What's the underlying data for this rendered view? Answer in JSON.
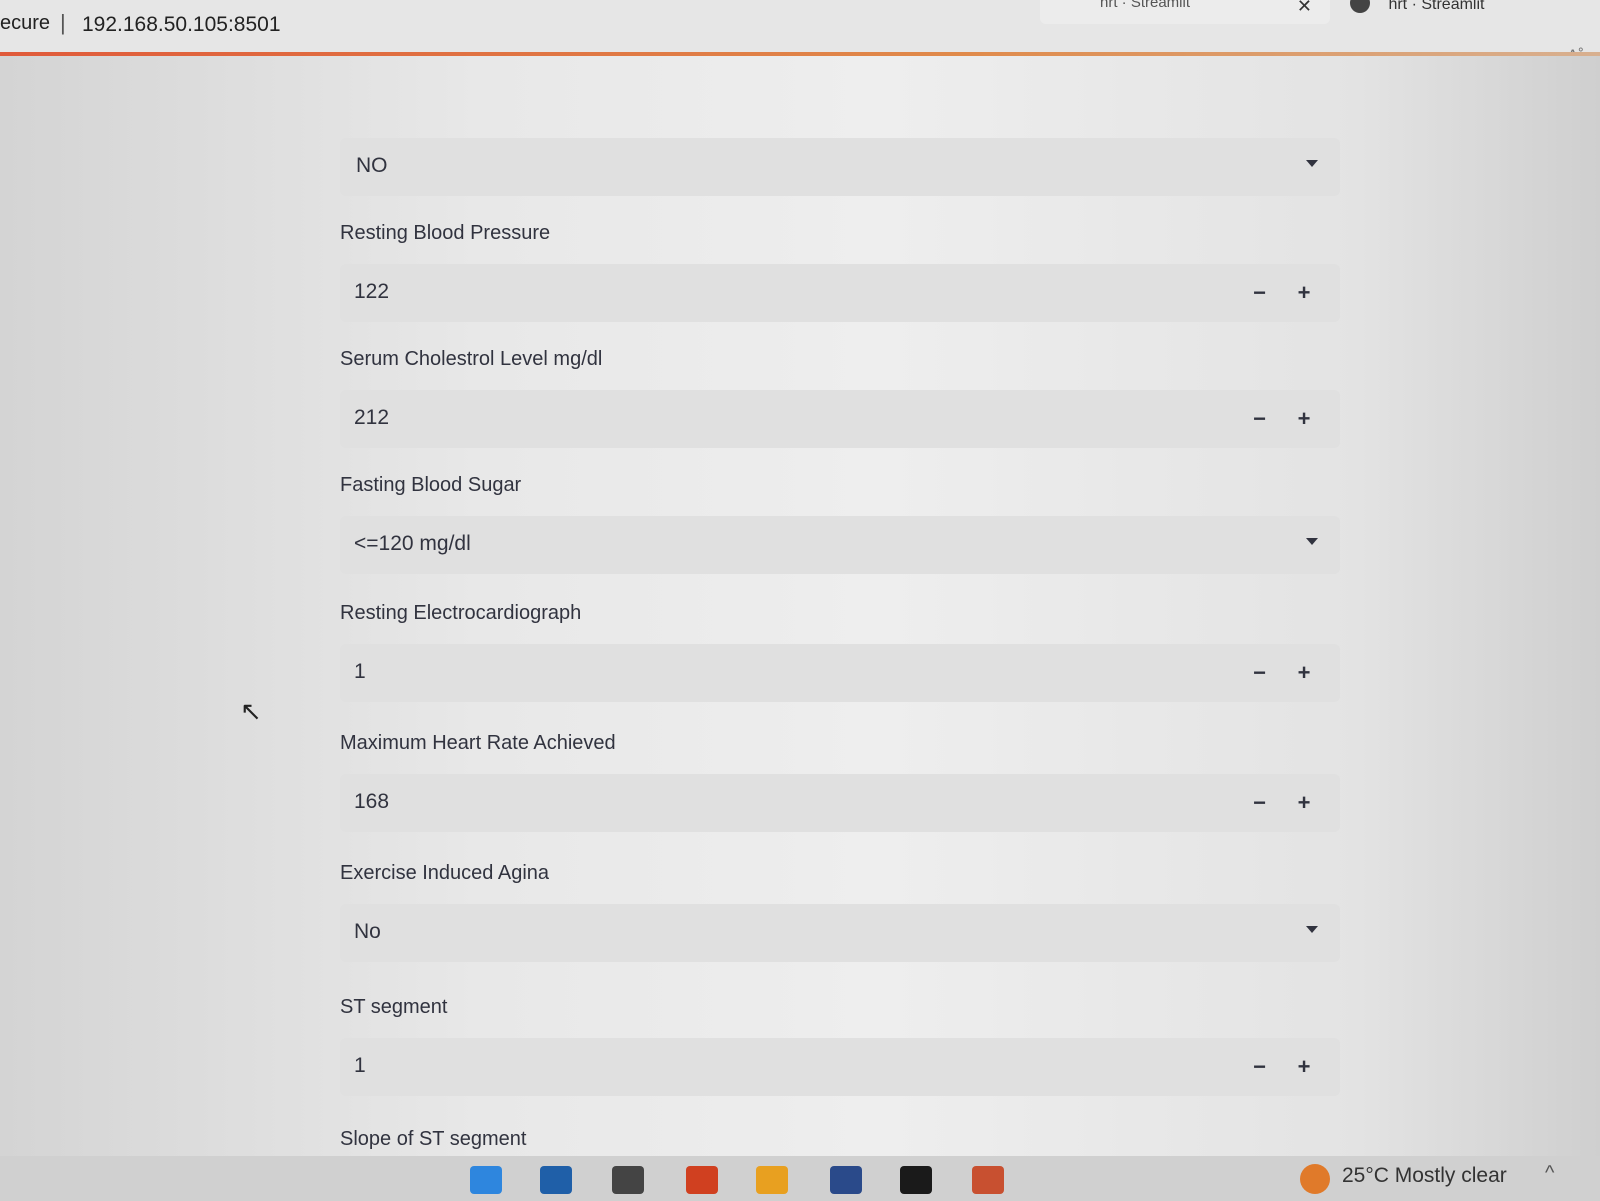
{
  "browser": {
    "address_prefix": "ecure",
    "address_sep": "|",
    "url": "192.168.50.105:8501",
    "tab1_label": "hrt · Streamlit",
    "tab1_close": "✕",
    "tab2_label": "hrt · Streamlit",
    "read_aloud": "A˚"
  },
  "form": {
    "top_select_value": "NO",
    "resting_bp_label": "Resting Blood Pressure",
    "resting_bp_value": "122",
    "cholesterol_label": "Serum Cholestrol Level mg/dl",
    "cholesterol_value": "212",
    "fbs_label": "Fasting Blood Sugar",
    "fbs_value": "<=120 mg/dl",
    "ecg_label": "Resting Electrocardiograph",
    "ecg_value": "1",
    "max_hr_label": "Maximum Heart Rate Achieved",
    "max_hr_value": "168",
    "angina_label": "Exercise Induced Agina",
    "angina_value": "No",
    "st_label": "ST segment",
    "st_value": "1",
    "slope_label": "Slope of ST segment",
    "minus_symbol": "−",
    "plus_symbol": "+"
  },
  "taskbar": {
    "weather": "25°C  Mostly clear",
    "tray_caret": "^",
    "icon_colors": [
      "#2e86de",
      "#1f5fa8",
      "#444444",
      "#d04020",
      "#e8a020",
      "#2a4a8a",
      "#1a1a1a",
      "#c85030"
    ]
  }
}
